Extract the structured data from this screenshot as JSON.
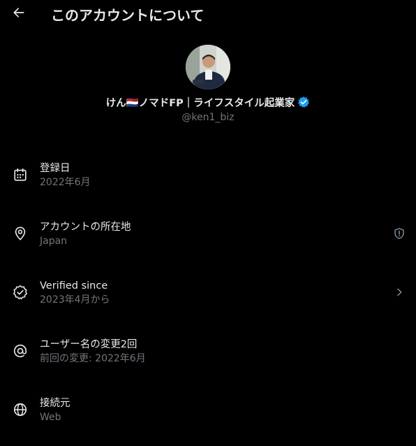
{
  "header": {
    "title": "このアカウントについて",
    "back_icon": "arrow-left-icon"
  },
  "profile": {
    "display_name": "けん🇳🇱ノマドFP｜ライフスタイル起業家",
    "handle": "@ken1_biz",
    "verified": true,
    "verified_color": "#1d9bf0"
  },
  "info_items": [
    {
      "icon": "calendar-icon",
      "label": "登録日",
      "value": "2022年6月"
    },
    {
      "icon": "location-pin-icon",
      "label": "アカウントの所在地",
      "value": "Japan",
      "trailing_icon": "shield-alert-icon"
    },
    {
      "icon": "verified-check-icon",
      "label": "Verified since",
      "value": "2023年4月から",
      "trailing_icon": "chevron-right-icon"
    },
    {
      "icon": "at-sign-icon",
      "label": "ユーザー名の変更2回",
      "value": "前回の変更: 2022年6月"
    },
    {
      "icon": "globe-icon",
      "label": "接続元",
      "value": "Web"
    }
  ],
  "colors": {
    "background": "#000000",
    "primary_text": "#e7e9ea",
    "secondary_text": "#71767b"
  }
}
